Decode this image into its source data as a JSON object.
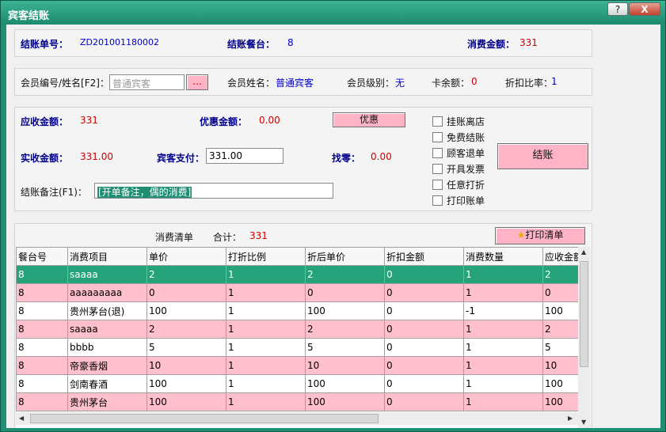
{
  "window": {
    "title": "宾客结账",
    "help_icon": "?",
    "close_icon": "X"
  },
  "summary": {
    "order_no_label": "结账单号：",
    "order_no": "ZD201001180002",
    "table_label": "结账餐台：",
    "table": "8",
    "consume_label": "消费金额：",
    "consume": "331"
  },
  "member": {
    "id_label": "会员编号/姓名[F2]：",
    "id_placeholder": "普通宾客",
    "browse": "...",
    "name_label": "会员姓名：",
    "name": "普通宾客",
    "level_label": "会员级别：",
    "level": "无",
    "balance_label": "卡余额：",
    "balance": "0",
    "discount_label": "折扣比率：",
    "discount": "1"
  },
  "payment": {
    "receivable_label": "应收金额：",
    "receivable": "331",
    "preferential_label": "优惠金额：",
    "preferential": "0.00",
    "preferential_button": "优惠",
    "actual_label": "实收金额：",
    "actual": "331.00",
    "guest_pay_label": "宾客支付：",
    "guest_pay": "331.00",
    "change_label": "找零：",
    "change": "0.00",
    "remark_label": "结账备注(F1)：",
    "remark": "[开单备注，偶的消费]",
    "checkout_button": "结账",
    "options": [
      "挂账离店",
      "免费结账",
      "顾客退单",
      "开具发票",
      "任意打折",
      "打印账单"
    ]
  },
  "list": {
    "title": "消费清单",
    "total_label": "合计：",
    "total": "331",
    "print_button": "打印清单",
    "columns": [
      "餐台号",
      "消费项目",
      "单价",
      "打折比例",
      "折后单价",
      "折扣金额",
      "消费数量",
      "应收金额"
    ],
    "rows": [
      [
        "8",
        "saaaa",
        "2",
        "1",
        "2",
        "0",
        "1",
        "2"
      ],
      [
        "8",
        "aaaaaaaaa",
        "0",
        "1",
        "0",
        "0",
        "1",
        "0"
      ],
      [
        "8",
        "贵州茅台(退)",
        "100",
        "1",
        "100",
        "0",
        "-1",
        "100"
      ],
      [
        "8",
        "saaaa",
        "2",
        "1",
        "2",
        "0",
        "1",
        "2"
      ],
      [
        "8",
        "bbbb",
        "5",
        "1",
        "5",
        "0",
        "1",
        "5"
      ],
      [
        "8",
        "帝豪香烟",
        "10",
        "1",
        "10",
        "0",
        "1",
        "10"
      ],
      [
        "8",
        "剑南春酒",
        "100",
        "1",
        "100",
        "0",
        "1",
        "100"
      ],
      [
        "8",
        "贵州茅台",
        "100",
        "1",
        "100",
        "0",
        "1",
        "100"
      ]
    ]
  }
}
